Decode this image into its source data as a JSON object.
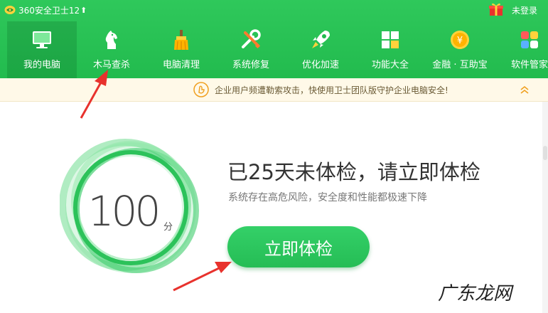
{
  "titlebar": {
    "app_title": "360安全卫士12",
    "up_arrow": "⬆",
    "login": "未登录"
  },
  "nav": {
    "items": [
      {
        "label": "我的电脑",
        "icon": "monitor-icon",
        "active": true
      },
      {
        "label": "木马查杀",
        "icon": "horse-icon"
      },
      {
        "label": "电脑清理",
        "icon": "broom-icon"
      },
      {
        "label": "系统修复",
        "icon": "tools-icon"
      },
      {
        "label": "优化加速",
        "icon": "rocket-icon"
      },
      {
        "label": "功能大全",
        "icon": "grid-icon"
      },
      {
        "label": "金融 · 互助宝",
        "icon": "coin-icon"
      },
      {
        "label": "软件管家",
        "icon": "apps-icon"
      }
    ]
  },
  "notice": {
    "text": "企业用户频遭勒索攻击，快使用卫士团队版守护企业电脑安全!"
  },
  "main": {
    "score": "100",
    "score_unit": "分",
    "headline": "已25天未体检，请立即体检",
    "subline": "系统存在高危风险，安全度和性能都极速下降",
    "scan_button": "立即体检"
  },
  "watermark": "广东龙网",
  "colors": {
    "header_green": "#22bb4e",
    "button_green": "#2cc660",
    "arrow_red": "#e8322d",
    "notice_bg": "#fff9e8"
  }
}
